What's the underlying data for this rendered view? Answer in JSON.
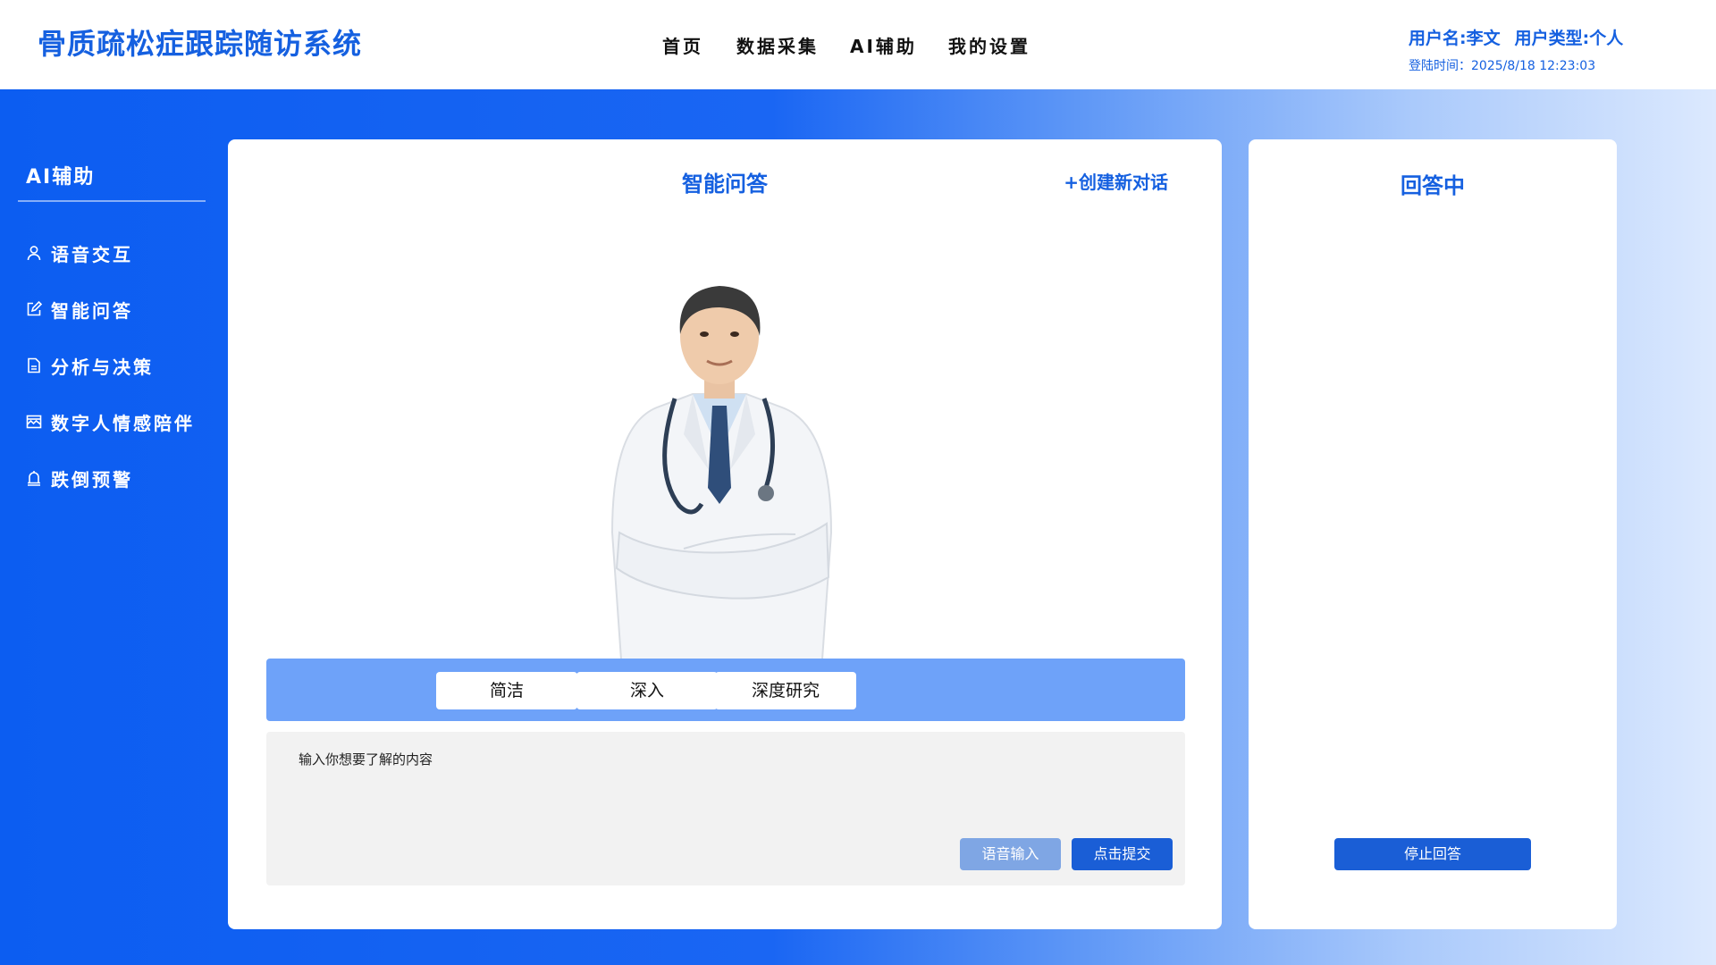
{
  "app": {
    "title": "骨质疏松症跟踪随访系统"
  },
  "nav": {
    "items": [
      "首页",
      "数据采集",
      "AI辅助",
      "我的设置"
    ]
  },
  "user": {
    "name_label": "用户名:李文",
    "type_label": "用户类型:个人",
    "login_time": "登陆时间：2025/8/18 12:23:03"
  },
  "sidebar": {
    "title": "AI辅助",
    "items": [
      {
        "label": "语音交互",
        "icon": "user-icon"
      },
      {
        "label": "智能问答",
        "icon": "edit-icon"
      },
      {
        "label": "分析与决策",
        "icon": "document-icon"
      },
      {
        "label": "数字人情感陪伴",
        "icon": "image-icon"
      },
      {
        "label": "跌倒预警",
        "icon": "alarm-icon"
      }
    ]
  },
  "main": {
    "title": "智能问答",
    "new_chat": "+创建新对话",
    "modes": [
      "简洁",
      "深入",
      "深度研究"
    ],
    "input_placeholder": "输入你想要了解的内容",
    "voice_button": "语音输入",
    "submit_button": "点击提交"
  },
  "answer_panel": {
    "title": "回答中",
    "stop_button": "停止回答"
  },
  "colors": {
    "brand": "#1560e0",
    "sidebar_bg": "#0c5df1",
    "mode_bar": "#6ea2f9",
    "button_primary": "#1a5ed6",
    "button_secondary": "#7fa6e4"
  }
}
